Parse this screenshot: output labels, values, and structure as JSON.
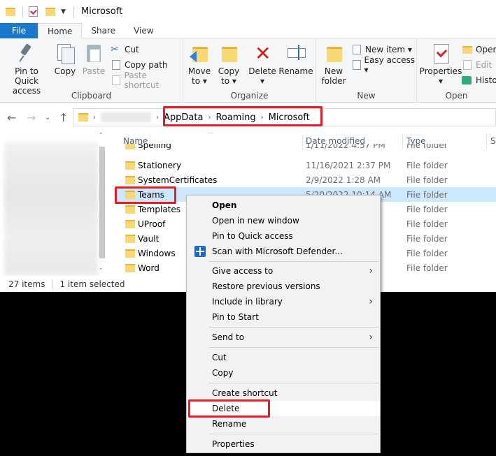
{
  "window": {
    "title": "Microsoft"
  },
  "ribbon_tabs": [
    {
      "label": "File"
    },
    {
      "label": "Home"
    },
    {
      "label": "Share"
    },
    {
      "label": "View"
    }
  ],
  "ribbon": {
    "clipboard": {
      "pin_label_1": "Pin to Quick",
      "pin_label_2": "access",
      "copy_label": "Copy",
      "paste_label": "Paste",
      "cut_label": "Cut",
      "copy_path_label": "Copy path",
      "paste_shortcut_label": "Paste shortcut",
      "group_label": "Clipboard"
    },
    "organize": {
      "move_to_1": "Move",
      "move_to_2": "to",
      "copy_to_1": "Copy",
      "copy_to_2": "to",
      "delete_label": "Delete",
      "rename_label": "Rename",
      "group_label": "Organize"
    },
    "new": {
      "new_folder_1": "New",
      "new_folder_2": "folder",
      "new_item_label": "New item",
      "easy_access_label": "Easy access",
      "group_label": "New"
    },
    "open": {
      "properties_label": "Properties",
      "open_label": "Open",
      "edit_label": "Edit",
      "history_label": "Histo",
      "group_label": "Open"
    }
  },
  "address": {
    "crumbs": [
      "AppData",
      "Roaming",
      "Microsoft"
    ]
  },
  "columns": {
    "name": "Name",
    "date_modified": "Date modified",
    "type": "Type",
    "size": "Si"
  },
  "files": [
    {
      "name": "Spelling",
      "date": "1/11/2022 4:57 PM",
      "type": "File folder"
    },
    {
      "name": "Stationery",
      "date": "11/16/2021 2:37 PM",
      "type": "File folder"
    },
    {
      "name": "SystemCertificates",
      "date": "2/9/2022 1:28 AM",
      "type": "File folder"
    },
    {
      "name": "Teams",
      "date": "5/20/2022 10:14 AM",
      "type": "File folder"
    },
    {
      "name": "Templates",
      "date": "",
      "type": "File folder"
    },
    {
      "name": "UProof",
      "date": "",
      "type": "File folder"
    },
    {
      "name": "Vault",
      "date": "",
      "type": "File folder"
    },
    {
      "name": "Windows",
      "date": "",
      "type": "File folder"
    },
    {
      "name": "Word",
      "date": "",
      "type": "File folder"
    }
  ],
  "status": {
    "items": "27 items",
    "selected": "1 item selected"
  },
  "context_menu": {
    "open": "Open",
    "open_new_window": "Open in new window",
    "pin_quick": "Pin to Quick access",
    "scan_defender": "Scan with Microsoft Defender...",
    "give_access": "Give access to",
    "restore": "Restore previous versions",
    "include_library": "Include in library",
    "pin_start": "Pin to Start",
    "send_to": "Send to",
    "cut": "Cut",
    "copy": "Copy",
    "create_shortcut": "Create shortcut",
    "delete": "Delete",
    "rename": "Rename",
    "properties": "Properties"
  },
  "colors": {
    "file_tab": "#1979ca",
    "selection": "#cce8ff",
    "highlight": "#e51e25"
  }
}
